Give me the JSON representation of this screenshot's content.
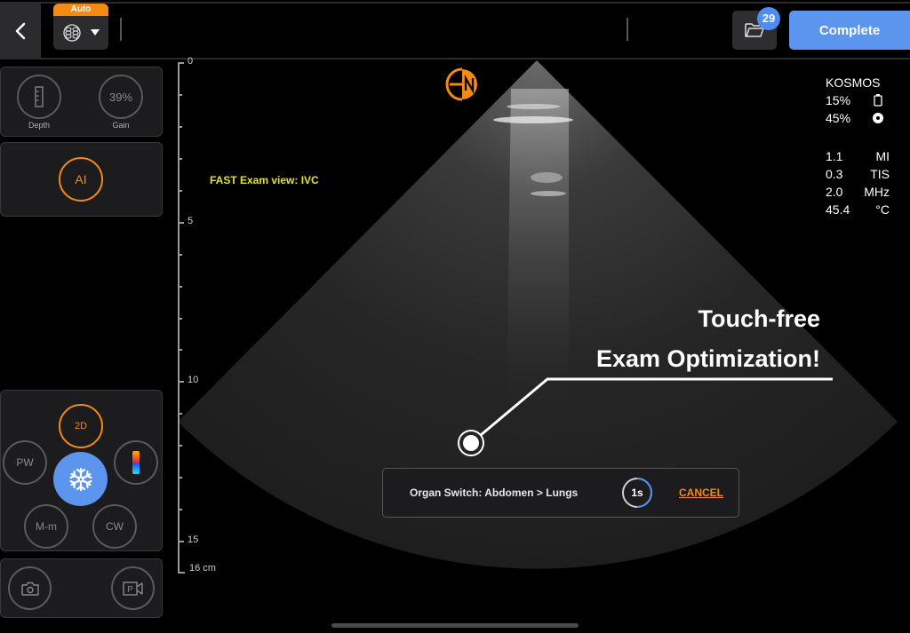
{
  "topbar": {
    "back_icon": "chevron-left-icon",
    "preset": {
      "badge": "Auto",
      "icon": "organ-preset-icon",
      "dropdown_icon": "caret-down-icon"
    },
    "folder": {
      "icon": "folder-open-icon",
      "count": "29"
    },
    "complete_label": "Complete"
  },
  "left_panel": {
    "imaging": {
      "depth": {
        "label": "Depth",
        "icon": "ruler-icon"
      },
      "gain": {
        "value": "39%",
        "label": "Gain"
      }
    },
    "ai": {
      "label": "AI"
    },
    "modes": {
      "two_d": "2D",
      "pw": "PW",
      "color": {
        "icon": "color-doppler-icon"
      },
      "freeze": {
        "icon": "snowflake-icon"
      },
      "mm": "M-m",
      "cw": "CW"
    },
    "capture": {
      "photo_icon": "camera-icon",
      "video_icon": "video-record-icon",
      "video_letter": "P"
    }
  },
  "depth_scale": {
    "unit_label": "16 cm",
    "max_cm": 16,
    "labels": [
      {
        "cm": 0,
        "text": "0"
      },
      {
        "cm": 5,
        "text": "5"
      },
      {
        "cm": 10,
        "text": "10"
      },
      {
        "cm": 15,
        "text": "15"
      }
    ],
    "minor_ticks_cm": [
      1,
      2,
      3,
      4,
      6,
      7,
      8,
      9,
      11,
      12,
      13,
      14
    ]
  },
  "image": {
    "exam_view": "FAST Exam view: IVC",
    "logo": "EN",
    "logo_color": "#f28a14",
    "device": "KOSMOS",
    "battery": {
      "value": "15%",
      "icon": "battery-icon"
    },
    "probe": {
      "value": "45%",
      "icon": "probe-charge-icon"
    },
    "params": [
      {
        "value": "1.1",
        "unit": "MI"
      },
      {
        "value": "0.3",
        "unit": "TIS"
      },
      {
        "value": "2.0",
        "unit": "MHz"
      },
      {
        "value": "45.4",
        "unit": "°C"
      }
    ]
  },
  "toast": {
    "message": "Organ Switch: Abdomen > Lungs",
    "countdown": "1s",
    "cancel_label": "CANCEL"
  },
  "promo": {
    "line1": "Touch-free",
    "line2": "Exam Optimization!"
  },
  "colors": {
    "accent_orange": "#f28a14",
    "primary_blue": "#5b95ee",
    "exam_text_yellow": "#e6e51c"
  }
}
